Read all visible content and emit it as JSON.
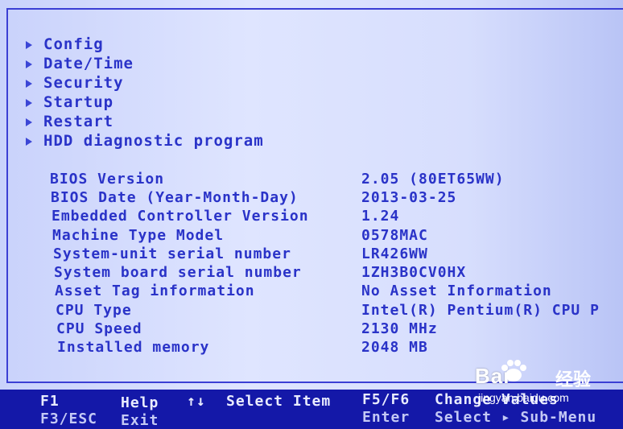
{
  "menu": {
    "items": [
      {
        "label": "Config"
      },
      {
        "label": "Date/Time"
      },
      {
        "label": "Security"
      },
      {
        "label": "Startup"
      },
      {
        "label": "Restart"
      },
      {
        "label": "HDD diagnostic program"
      }
    ]
  },
  "system_info": {
    "rows": [
      {
        "label": "BIOS Version",
        "value": "2.05   (80ET65WW)"
      },
      {
        "label": "BIOS Date (Year-Month-Day)",
        "value": "2013-03-25"
      },
      {
        "label": "Embedded Controller Version",
        "value": "1.24"
      },
      {
        "label": "Machine Type Model",
        "value": "0578MAC"
      },
      {
        "label": "System-unit serial number",
        "value": "LR426WW"
      },
      {
        "label": "System board serial number",
        "value": "1ZH3B0CV0HX"
      },
      {
        "label": "Asset Tag information",
        "value": "No Asset Information"
      },
      {
        "label": "CPU Type",
        "value": "Intel(R) Pentium(R) CPU P"
      },
      {
        "label": "CPU Speed",
        "value": "2130 MHz"
      },
      {
        "label": "Installed memory",
        "value": "2048 MB"
      }
    ]
  },
  "footer": {
    "f1_key": "F1",
    "f1_label": "Help",
    "arrows_key": "↑↓",
    "arrows_label": "Select Item",
    "f5f6_key": "F5/F6",
    "f5f6_label": "Change Values",
    "esc_key": "F3/ESC",
    "esc_label": "Exit",
    "enter_key": "Enter",
    "enter_label": "Select ▸ Sub-Menu"
  },
  "watermark": {
    "brand": "Bai",
    "brand_suffix": "经验",
    "url": "jingyan.baidu.com"
  }
}
